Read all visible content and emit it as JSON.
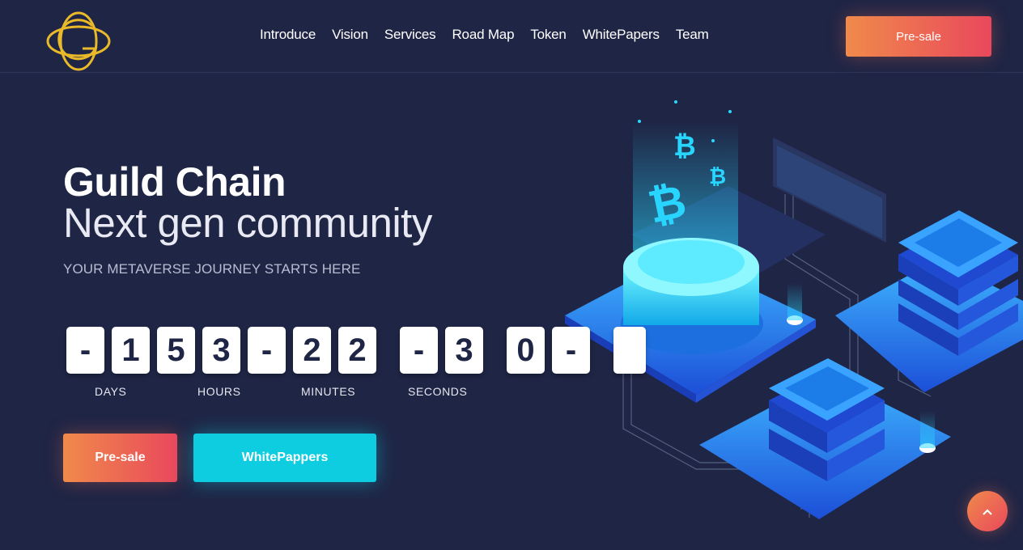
{
  "header": {
    "logo_icon": "guild-chain-logo",
    "nav": [
      "Introduce",
      "Vision",
      "Services",
      "Road Map",
      "Token",
      "WhitePapers",
      "Team"
    ],
    "presale_label": "Pre-sale"
  },
  "hero": {
    "title": "Guild Chain",
    "subtitle": "Next gen community",
    "tagline": "YOUR METAVERSE JOURNEY STARTS HERE"
  },
  "countdown": {
    "digits": [
      "-",
      "1",
      "5",
      "3",
      "-",
      "2",
      "2",
      "-",
      "3",
      "0",
      "-"
    ],
    "units": [
      "DAYS",
      "HOURS",
      "MINUTES",
      "SECONDS"
    ]
  },
  "cta": {
    "presale_label": "Pre-sale",
    "whitepaper_label": "WhitePappers"
  },
  "colors": {
    "background": "#1f2545",
    "accent_orange": "#f08a4b",
    "accent_red": "#e9485c",
    "accent_cyan": "#0ecde0",
    "logo_gold": "#e9b92a"
  },
  "scroll_top_icon": "chevron-up-icon"
}
